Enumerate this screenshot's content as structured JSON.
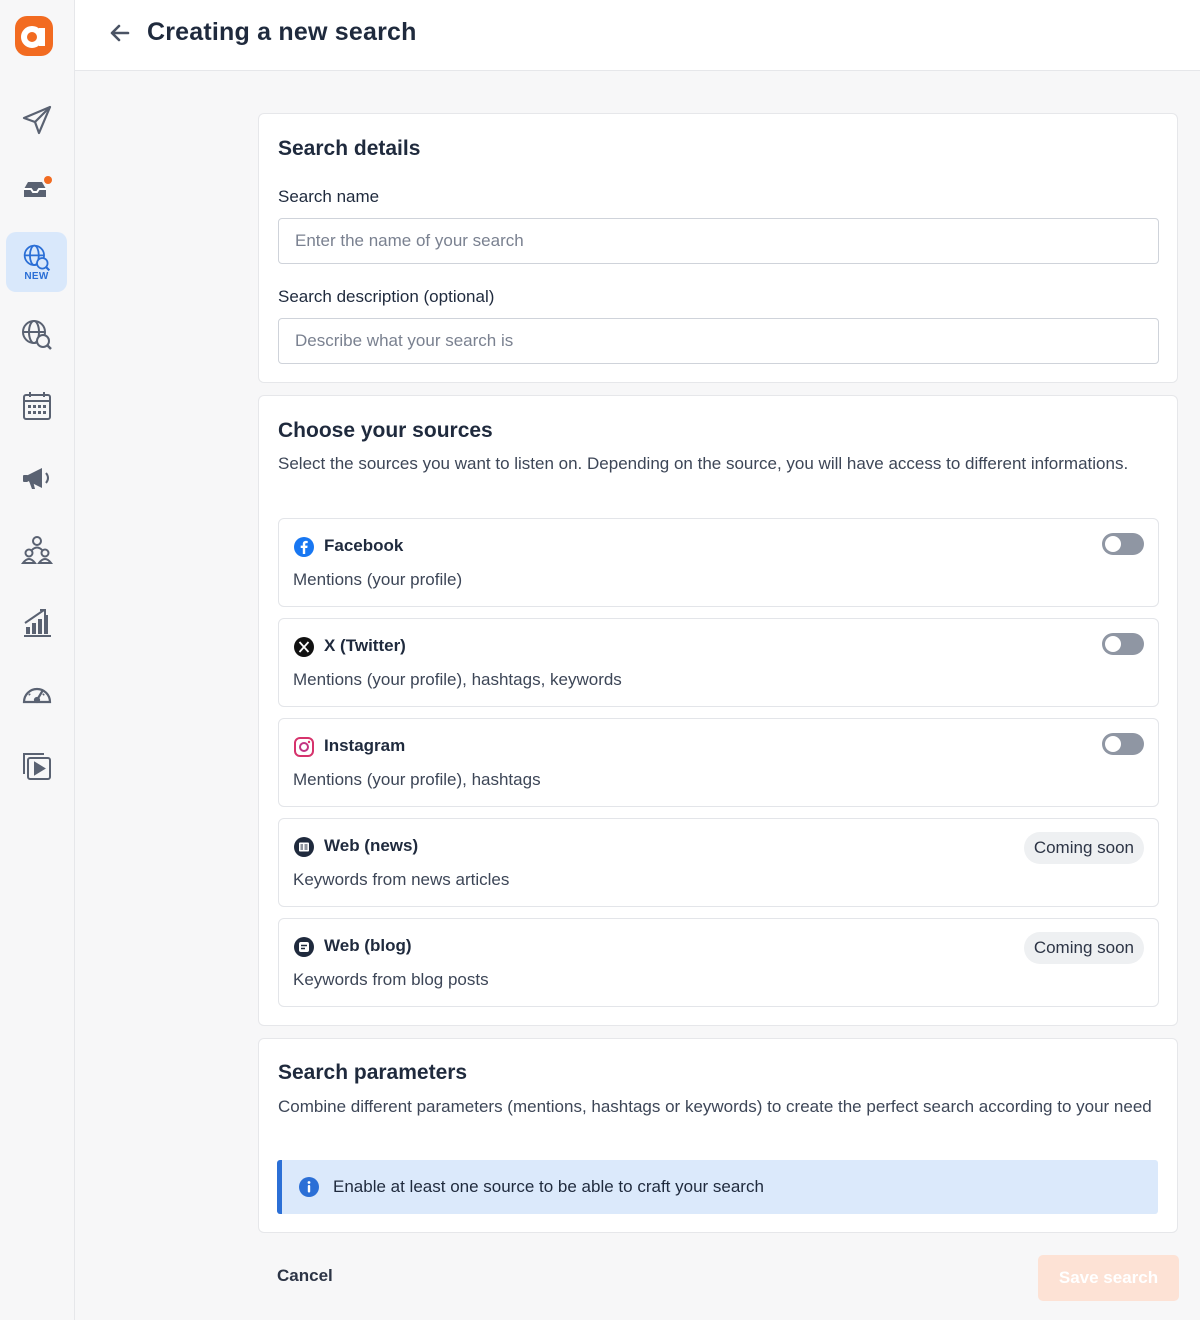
{
  "header": {
    "title": "Creating a new search"
  },
  "sidebar": {
    "new_badge": "NEW",
    "items": [
      {
        "icon": "paper-plane-icon"
      },
      {
        "icon": "inbox-icon"
      },
      {
        "icon": "globe-search-icon"
      },
      {
        "icon": "globe-search-icon"
      },
      {
        "icon": "calendar-icon"
      },
      {
        "icon": "megaphone-icon"
      },
      {
        "icon": "users-icon"
      },
      {
        "icon": "bar-chart-icon"
      },
      {
        "icon": "gauge-icon"
      },
      {
        "icon": "video-library-icon"
      }
    ]
  },
  "details": {
    "title": "Search details",
    "name_label": "Search name",
    "name_placeholder": "Enter the name of your search",
    "name_value": "",
    "desc_label": "Search description (optional)",
    "desc_placeholder": "Describe what your search is",
    "desc_value": ""
  },
  "sources": {
    "title": "Choose your sources",
    "description": "Select the sources you want to listen on. Depending on the source, you will have access to different informations.",
    "items": [
      {
        "name": "Facebook",
        "desc": "Mentions (your profile)",
        "icon": "facebook-icon",
        "enabled": false
      },
      {
        "name": "X (Twitter)",
        "desc": "Mentions (your profile), hashtags, keywords",
        "icon": "x-icon",
        "enabled": false
      },
      {
        "name": "Instagram",
        "desc": "Mentions (your profile), hashtags",
        "icon": "instagram-icon",
        "enabled": false
      },
      {
        "name": "Web (news)",
        "desc": "Keywords from news articles",
        "icon": "news-icon",
        "badge": "Coming soon"
      },
      {
        "name": "Web (blog)",
        "desc": "Keywords from blog posts",
        "icon": "blog-icon",
        "badge": "Coming soon"
      }
    ]
  },
  "parameters": {
    "title": "Search parameters",
    "description": "Combine different parameters (mentions, hashtags or keywords) to create the perfect search according to your need",
    "info": "Enable at least one source to be able to craft your search"
  },
  "footer": {
    "cancel": "Cancel",
    "save": "Save search"
  },
  "colors": {
    "accent": "#f26b21",
    "info_blue": "#2b6fd6",
    "info_bg": "#dbe9fb",
    "active_nav": "#d9e8fb"
  }
}
